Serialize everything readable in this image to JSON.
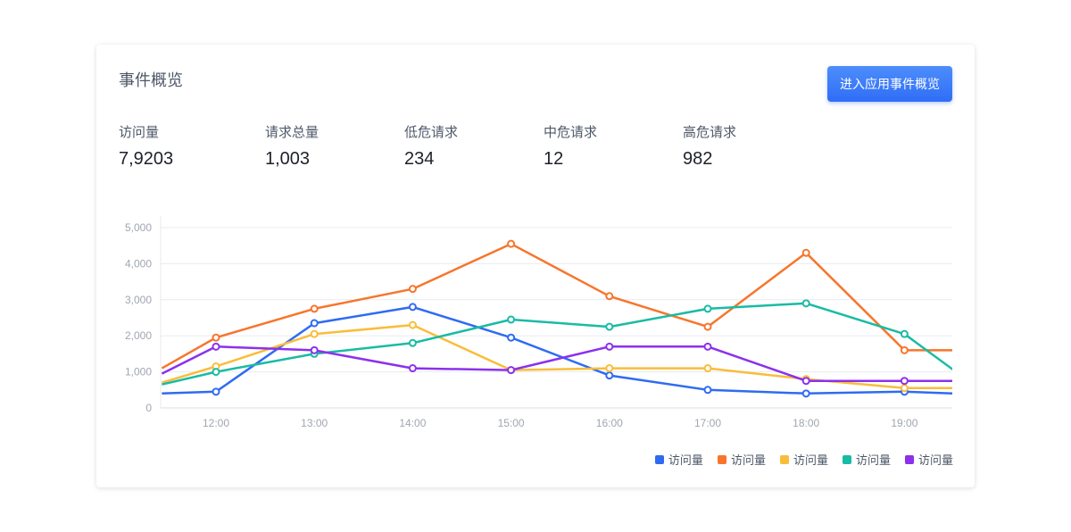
{
  "header": {
    "title": "事件概览",
    "button_label": "进入应用事件概览"
  },
  "stats": [
    {
      "label": "访问量",
      "value": "7,9203"
    },
    {
      "label": "请求总量",
      "value": "1,003"
    },
    {
      "label": "低危请求",
      "value": "234"
    },
    {
      "label": "中危请求",
      "value": "12"
    },
    {
      "label": "高危请求",
      "value": "982"
    }
  ],
  "chart_data": {
    "type": "line",
    "categories": [
      "12:00",
      "13:00",
      "14:00",
      "15:00",
      "16:00",
      "17:00",
      "18:00",
      "19:00"
    ],
    "x_values": [
      11.45,
      12.0,
      13.0,
      14.0,
      15.0,
      16.0,
      17.0,
      18.0,
      19.0,
      19.5
    ],
    "y_ticks": [
      "0",
      "1,000",
      "2,000",
      "3,000",
      "4,000",
      "5,000"
    ],
    "ylim": [
      0,
      5000
    ],
    "grid": true,
    "legend_position": "bottom-right",
    "series": [
      {
        "name": "访问量",
        "color": "#2f6bf2",
        "values": [
          400,
          450,
          2350,
          2800,
          1950,
          900,
          500,
          400,
          450,
          400
        ]
      },
      {
        "name": "访问量",
        "color": "#f7752c",
        "values": [
          1100,
          1950,
          2750,
          3300,
          4550,
          3100,
          2250,
          4300,
          1600,
          1600
        ]
      },
      {
        "name": "访问量",
        "color": "#f9bd3a",
        "values": [
          700,
          1150,
          2050,
          2300,
          1050,
          1100,
          1100,
          800,
          550,
          550
        ]
      },
      {
        "name": "访问量",
        "color": "#19bba4",
        "values": [
          650,
          1000,
          1500,
          1800,
          2450,
          2250,
          2750,
          2900,
          2050,
          1050
        ]
      },
      {
        "name": "访问量",
        "color": "#8c30ec",
        "values": [
          950,
          1700,
          1600,
          1100,
          1050,
          1700,
          1700,
          750,
          750,
          750
        ]
      }
    ]
  }
}
